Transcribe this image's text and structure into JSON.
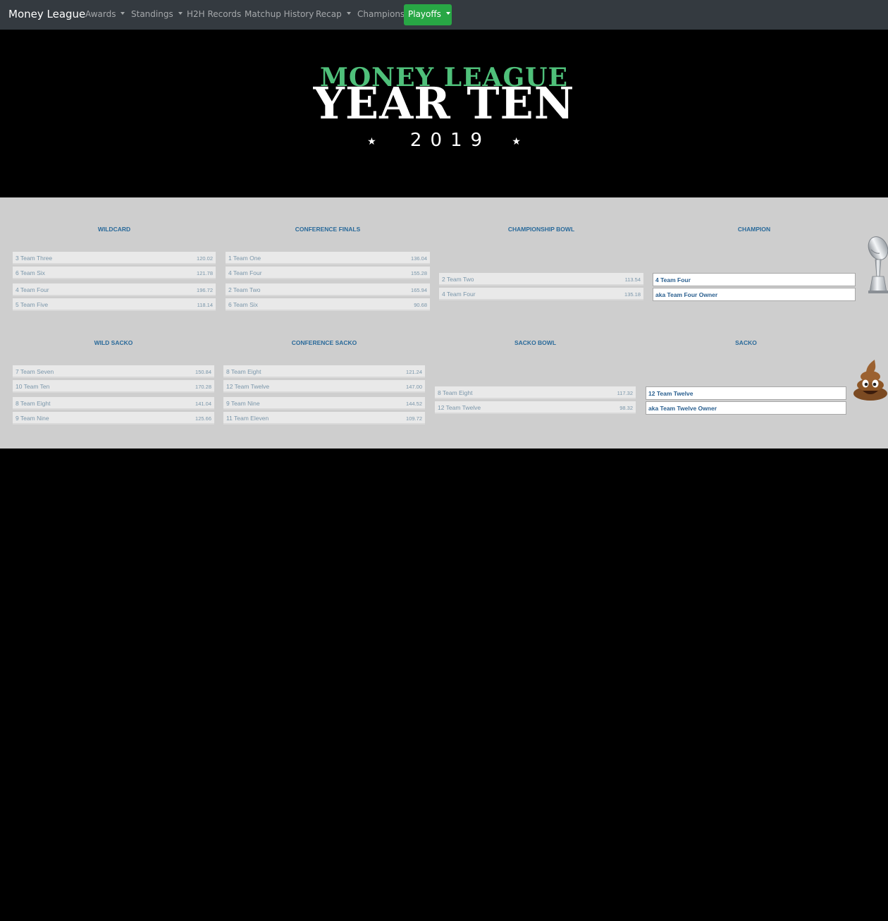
{
  "nav": {
    "brand": "Money League",
    "items": [
      {
        "label": "Awards"
      },
      {
        "label": "Standings"
      },
      {
        "label": "H2H Records"
      },
      {
        "label": "Matchup History"
      },
      {
        "label": "Recap"
      },
      {
        "label": "Champions"
      }
    ],
    "active": "Playoffs",
    "active_color": "#28a745"
  },
  "hero": {
    "line1": "MONEY LEAGUE",
    "line2": "YEAR TEN",
    "year": "2019",
    "accent": "#4fc07a"
  },
  "bracket": {
    "titles": [
      "WILDCARD",
      "CONFERENCE FINALS",
      "CHAMPIONSHIP BOWL",
      "CHAMPION",
      "WILD SACKO",
      "CONFERENCE SACKO",
      "SACKO BOWL",
      "SACKO"
    ],
    "wildcard": [
      {
        "seed": "3",
        "name": "Team Three",
        "score": "120.02"
      },
      {
        "seed": "6",
        "name": "Team Six",
        "score": "121.78"
      },
      {
        "seed": "4",
        "name": "Team Four",
        "score": "196.72"
      },
      {
        "seed": "5",
        "name": "Team Five",
        "score": "118.14"
      }
    ],
    "conference_finals": [
      {
        "seed": "1",
        "name": "Team One",
        "score": "136.04"
      },
      {
        "seed": "4",
        "name": "Team Four",
        "score": "155.28"
      },
      {
        "seed": "2",
        "name": "Team Two",
        "score": "165.94"
      },
      {
        "seed": "6",
        "name": "Team Six",
        "score": "90.68"
      }
    ],
    "championship_bowl": [
      {
        "seed": "2",
        "name": "Team Two",
        "score": "113.54"
      },
      {
        "seed": "4",
        "name": "Team Four",
        "score": "135.18"
      }
    ],
    "champion": {
      "team": "4  Team Four",
      "owner": "aka Team Four Owner"
    },
    "wild_sacko": [
      {
        "seed": "7",
        "name": "Team Seven",
        "score": "150.84"
      },
      {
        "seed": "10",
        "name": "Team Ten",
        "score": "170.28"
      },
      {
        "seed": "8",
        "name": "Team Eight",
        "score": "141.04"
      },
      {
        "seed": "9",
        "name": "Team Nine",
        "score": "125.66"
      }
    ],
    "conference_sacko": [
      {
        "seed": "8",
        "name": "Team Eight",
        "score": "121.24"
      },
      {
        "seed": "12",
        "name": "Team Twelve",
        "score": "147.00"
      },
      {
        "seed": "9",
        "name": "Team Nine",
        "score": "144.52"
      },
      {
        "seed": "11",
        "name": "Team Eleven",
        "score": "109.72"
      }
    ],
    "sacko_bowl": [
      {
        "seed": "8",
        "name": "Team Eight",
        "score": "117.32"
      },
      {
        "seed": "12",
        "name": "Team Twelve",
        "score": "98.32"
      }
    ],
    "sacko": {
      "team": "12 Team Twelve",
      "owner": "aka Team Twelve Owner"
    },
    "trophy_icon": "trophy-icon",
    "poop_icon": "poop-emoji-icon"
  }
}
